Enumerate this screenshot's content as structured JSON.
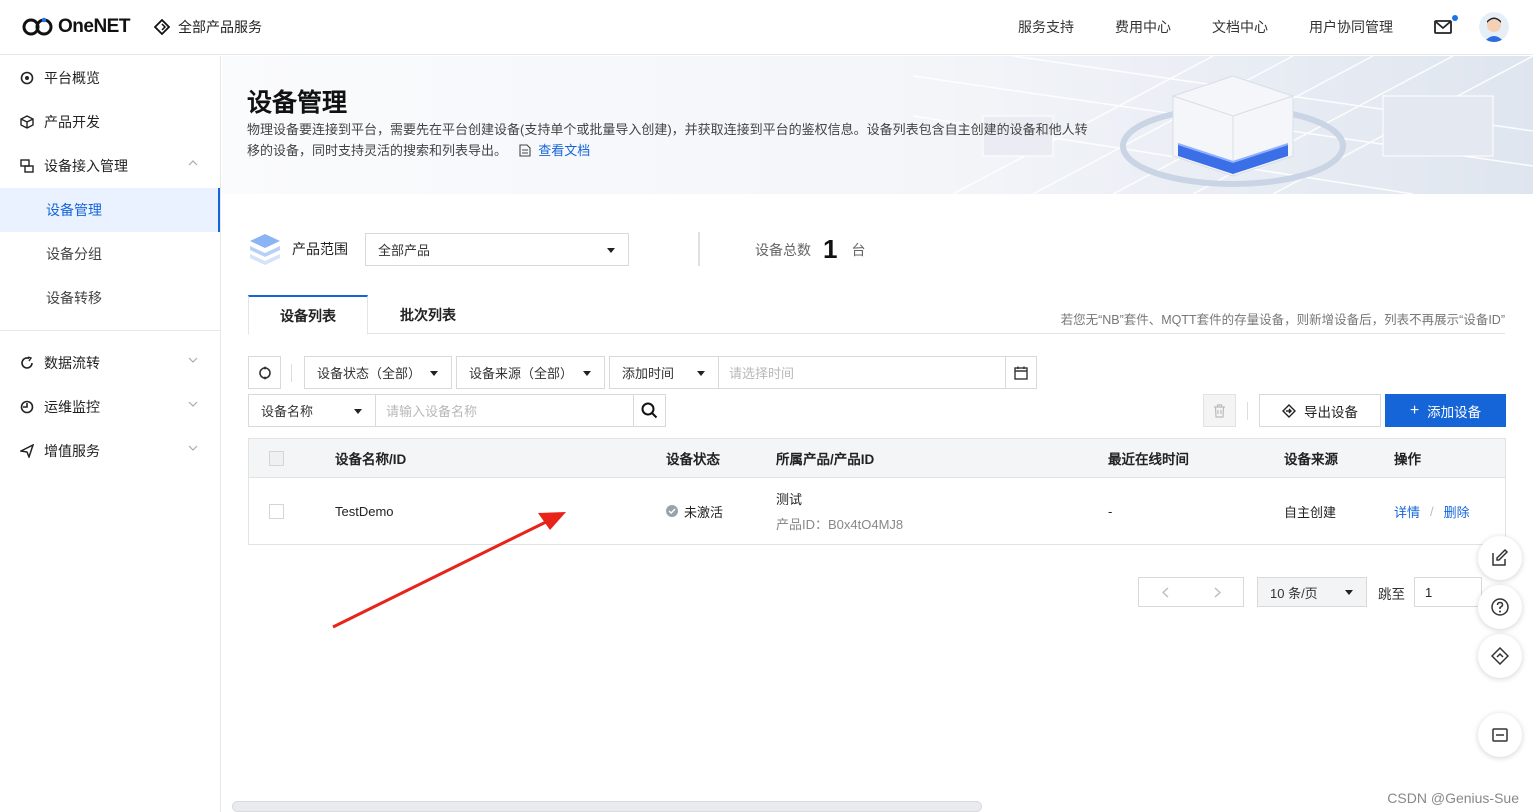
{
  "header": {
    "logo_text": "OneNET",
    "all_products": "全部产品服务",
    "nav": [
      "服务支持",
      "费用中心",
      "文档中心",
      "用户协同管理"
    ]
  },
  "sidebar": {
    "items": [
      {
        "label": "平台概览",
        "icon": "dashboard-icon"
      },
      {
        "label": "产品开发",
        "icon": "cube-icon"
      },
      {
        "label": "设备接入管理",
        "icon": "device-access-icon"
      },
      {
        "label": "数据流转",
        "icon": "data-flow-icon"
      },
      {
        "label": "运维监控",
        "icon": "monitor-icon"
      },
      {
        "label": "增值服务",
        "icon": "send-icon"
      }
    ],
    "sub_items": [
      "设备管理",
      "设备分组",
      "设备转移"
    ]
  },
  "banner": {
    "title": "设备管理",
    "description": "物理设备要连接到平台，需要先在平台创建设备(支持单个或批量导入创建)，并获取连接到平台的鉴权信息。设备列表包含自主创建的设备和他人转移的设备，同时支持灵活的搜索和列表导出。",
    "doc_link": "查看文档"
  },
  "scope": {
    "label": "产品范围",
    "selected": "全部产品",
    "total_label": "设备总数",
    "total_value": "1",
    "total_unit": "台"
  },
  "tabs": {
    "items": [
      "设备列表",
      "批次列表"
    ],
    "note": "若您无“NB”套件、MQTT套件的存量设备，则新增设备后，列表不再展示“设备ID”"
  },
  "filters": {
    "status": "设备状态（全部）",
    "source": "设备来源（全部）",
    "time_field": "添加时间",
    "time_placeholder": "请选择时间",
    "search_field": "设备名称",
    "search_placeholder": "请输入设备名称",
    "export_label": "导出设备",
    "add_label": "添加设备"
  },
  "table": {
    "headers": [
      "设备名称/ID",
      "设备状态",
      "所属产品/产品ID",
      "最近在线时间",
      "设备来源",
      "操作"
    ],
    "rows": [
      {
        "name": "TestDemo",
        "status": "未激活",
        "product": "测试",
        "product_id": "产品ID：B0x4tO4MJ8",
        "last_online": "-",
        "source": "自主创建",
        "action_detail": "详情",
        "action_sep": "/",
        "action_delete": "删除"
      }
    ]
  },
  "pagination": {
    "page_size": "10 条/页",
    "jump_label": "跳至",
    "jump_value": "1"
  },
  "watermark": "CSDN @Genius-Sue",
  "colors": {
    "accent": "#1665d8",
    "annotation_arrow": "#e8231a"
  }
}
